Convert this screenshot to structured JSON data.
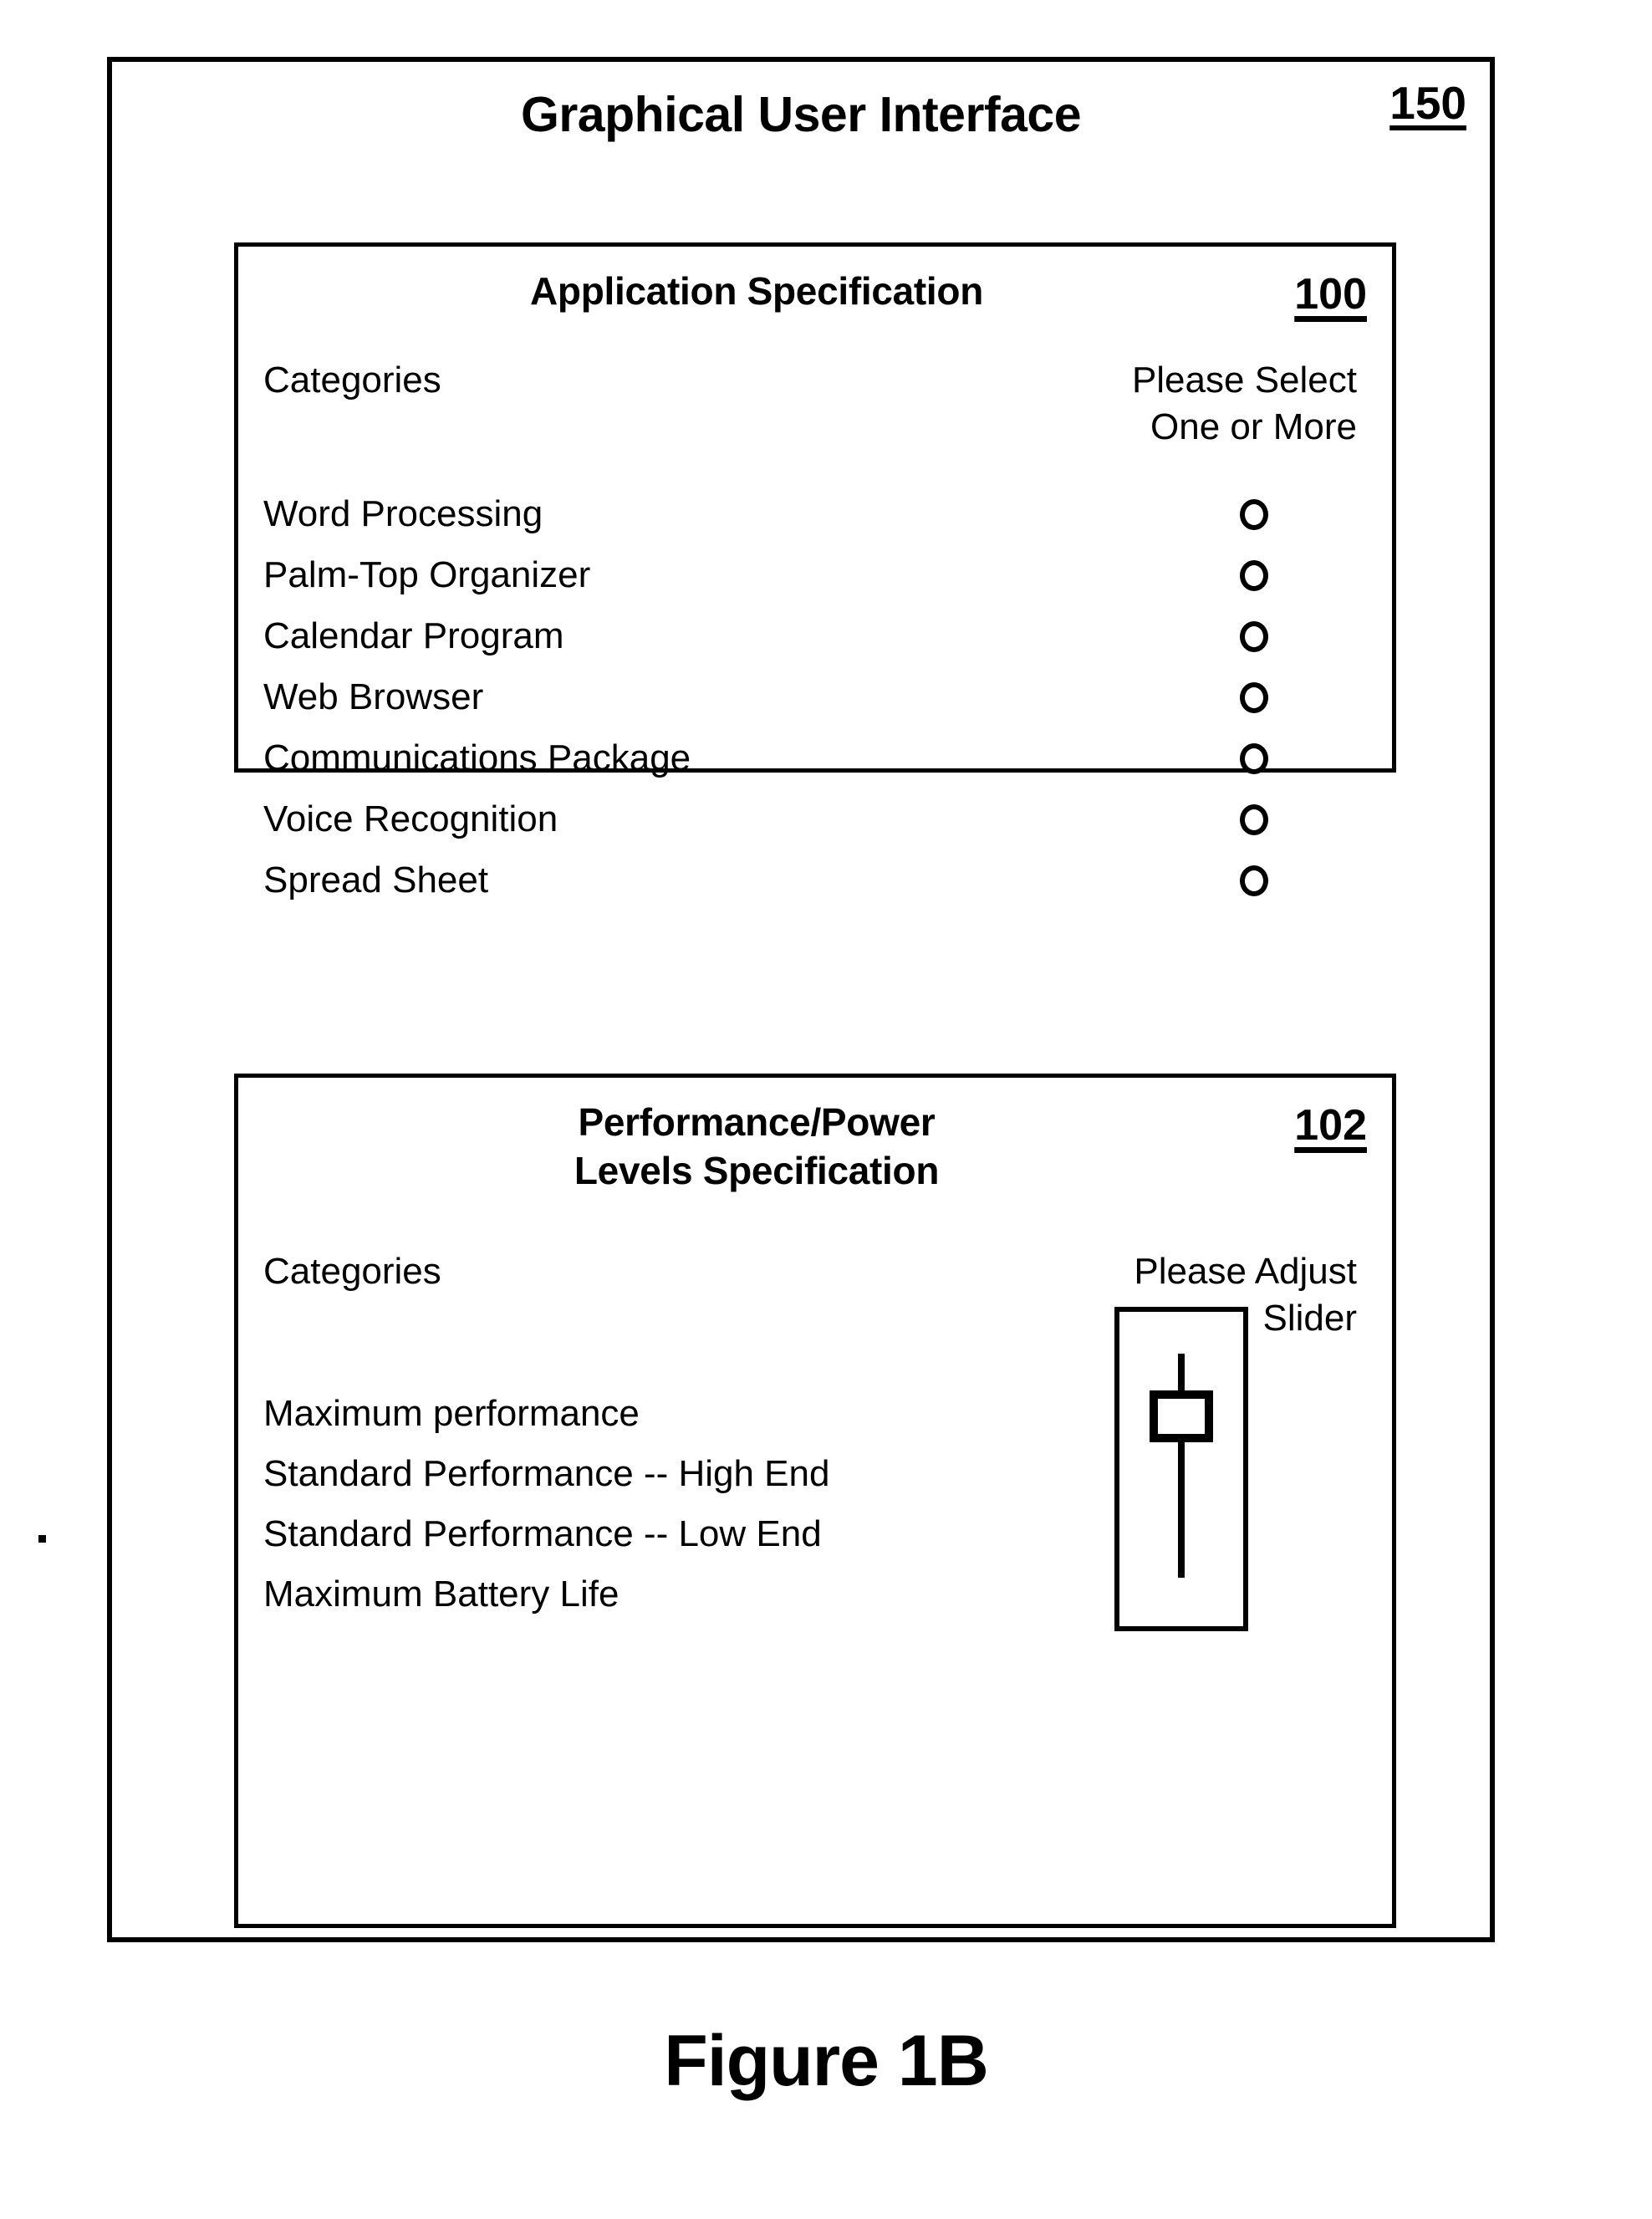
{
  "figure": {
    "caption": "Figure 1B"
  },
  "gui": {
    "title": "Graphical User Interface",
    "reference": "150"
  },
  "application_spec": {
    "title": "Application Specification",
    "reference": "100",
    "left_heading": "Categories",
    "right_heading_line1": "Please Select",
    "right_heading_line2": "One or More",
    "options": [
      {
        "label": "Word Processing",
        "control": "radio-unselected"
      },
      {
        "label": "Palm-Top Organizer",
        "control": "radio-unselected"
      },
      {
        "label": "Calendar Program",
        "control": "radio-unselected"
      },
      {
        "label": "Web Browser",
        "control": "radio-unselected"
      },
      {
        "label": "Communications Package",
        "control": "radio-unselected"
      },
      {
        "label": "Voice Recognition",
        "control": "radio-unselected"
      },
      {
        "label": "Spread Sheet",
        "control": "radio-unselected"
      }
    ]
  },
  "performance_spec": {
    "title_line1": "Performance/Power",
    "title_line2": "Levels Specification",
    "reference": "102",
    "left_heading": "Categories",
    "right_heading_line1": "Please Adjust",
    "right_heading_line2": "Slider",
    "levels": [
      {
        "label": "Maximum performance"
      },
      {
        "label": "Standard Performance -- High End"
      },
      {
        "label": "Standard Performance -- Low End"
      },
      {
        "label": "Maximum Battery Life"
      }
    ],
    "slider": {
      "orientation": "vertical",
      "thumb_position_label": "Standard Performance -- High End",
      "thumb_position_index": 1
    }
  },
  "colors": {
    "ink": "#000000",
    "paper": "#ffffff"
  }
}
